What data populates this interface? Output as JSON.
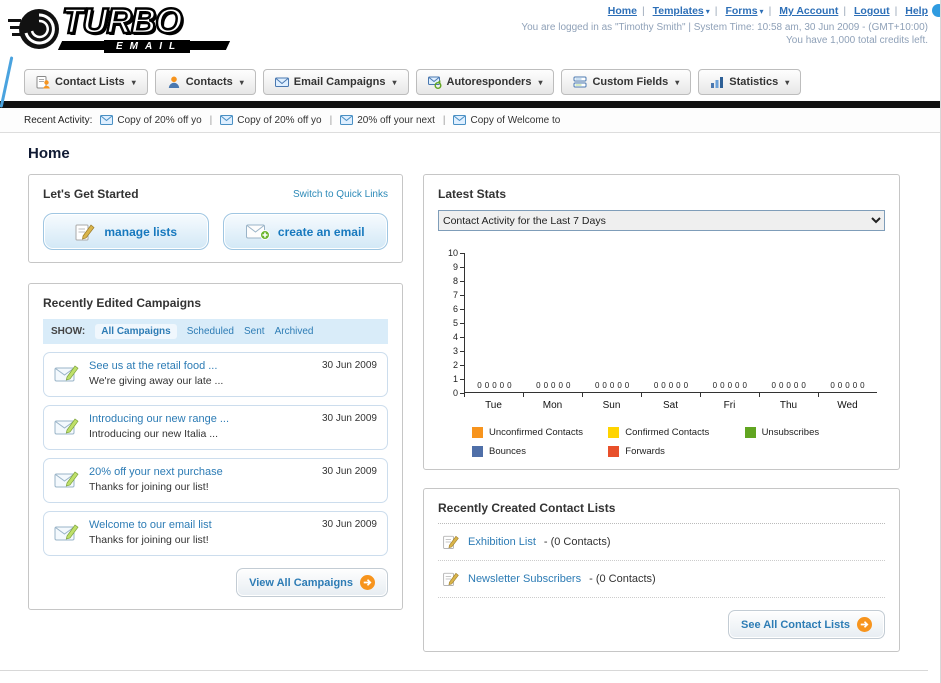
{
  "colors": {
    "link_blue": "#2d7cb5",
    "accent_orange": "#f7941d",
    "bar_black": "#121212",
    "filter_bar_blue": "#d9ecf9"
  },
  "header": {
    "logo": {
      "title": "TURBO",
      "subtitle": "EMAIL"
    },
    "nav": [
      {
        "label": "Home"
      },
      {
        "label": "Templates"
      },
      {
        "label": "Forms"
      },
      {
        "label": "My Account"
      },
      {
        "label": "Logout"
      },
      {
        "label": "Help"
      }
    ],
    "login_info": "You are logged in as \"Timothy Smith\" | System Time: 10:58 am, 30 Jun 2009 - (GMT+10:00)",
    "credits_info": "You have 1,000 total credits left."
  },
  "nav_tabs": [
    {
      "label": "Contact Lists"
    },
    {
      "label": "Contacts"
    },
    {
      "label": "Email Campaigns"
    },
    {
      "label": "Autoresponders"
    },
    {
      "label": "Custom Fields"
    },
    {
      "label": "Statistics"
    }
  ],
  "recent_activity": {
    "label": "Recent Activity:",
    "items": [
      {
        "text": "Copy of 20% off yo"
      },
      {
        "text": "Copy of 20% off yo"
      },
      {
        "text": "20% off your next"
      },
      {
        "text": "Copy of Welcome to"
      }
    ]
  },
  "page_title": "Home",
  "get_started": {
    "title": "Let's Get Started",
    "switch_link": "Switch to Quick Links",
    "manage_lists_label": "manage lists",
    "create_email_label": "create an email"
  },
  "campaigns": {
    "title": "Recently Edited Campaigns",
    "show_label": "SHOW:",
    "filters": [
      {
        "label": "All Campaigns",
        "selected": true
      },
      {
        "label": "Scheduled",
        "selected": false
      },
      {
        "label": "Sent",
        "selected": false
      },
      {
        "label": "Archived",
        "selected": false
      }
    ],
    "items": [
      {
        "title": "See us at the retail food ...",
        "subtitle": "We're giving away our late ...",
        "date": "30 Jun 2009"
      },
      {
        "title": "Introducing our new range ...",
        "subtitle": "Introducing our new Italia ...",
        "date": "30 Jun 2009"
      },
      {
        "title": "20% off your next purchase",
        "subtitle": "Thanks for joining our list!",
        "date": "30 Jun 2009"
      },
      {
        "title": "Welcome to our email list",
        "subtitle": "Thanks for joining our list!",
        "date": "30 Jun 2009"
      }
    ],
    "view_all_label": "View All Campaigns"
  },
  "stats": {
    "title": "Latest Stats",
    "period": "Contact Activity for the Last 7 Days",
    "chart_data": {
      "type": "bar",
      "categories": [
        "Tue",
        "Mon",
        "Sun",
        "Sat",
        "Fri",
        "Thu",
        "Wed"
      ],
      "series": [
        {
          "name": "Unconfirmed Contacts",
          "color": "#f7941d",
          "values": [
            0,
            0,
            0,
            0,
            0,
            0,
            0
          ]
        },
        {
          "name": "Confirmed Contacts",
          "color": "#ffd400",
          "values": [
            0,
            0,
            0,
            0,
            0,
            0,
            0
          ]
        },
        {
          "name": "Unsubscribes",
          "color": "#61a521",
          "values": [
            0,
            0,
            0,
            0,
            0,
            0,
            0
          ]
        },
        {
          "name": "Bounces",
          "color": "#4f6fa8",
          "values": [
            0,
            0,
            0,
            0,
            0,
            0,
            0
          ]
        },
        {
          "name": "Forwards",
          "color": "#e8502b",
          "values": [
            0,
            0,
            0,
            0,
            0,
            0,
            0
          ]
        }
      ],
      "title": "Contact Activity for the Last 7 Days",
      "xlabel": "",
      "ylabel": "",
      "ylim": [
        0,
        10
      ],
      "yticks": [
        0,
        1,
        2,
        3,
        4,
        5,
        6,
        7,
        8,
        9,
        10
      ],
      "grid": false,
      "legend_position": "bottom"
    }
  },
  "contact_lists": {
    "title": "Recently Created Contact Lists",
    "items": [
      {
        "name": "Exhibition List",
        "count": "- (0 Contacts)"
      },
      {
        "name": "Newsletter Subscribers",
        "count": "- (0 Contacts)"
      }
    ],
    "see_all_label": "See All Contact Lists"
  }
}
